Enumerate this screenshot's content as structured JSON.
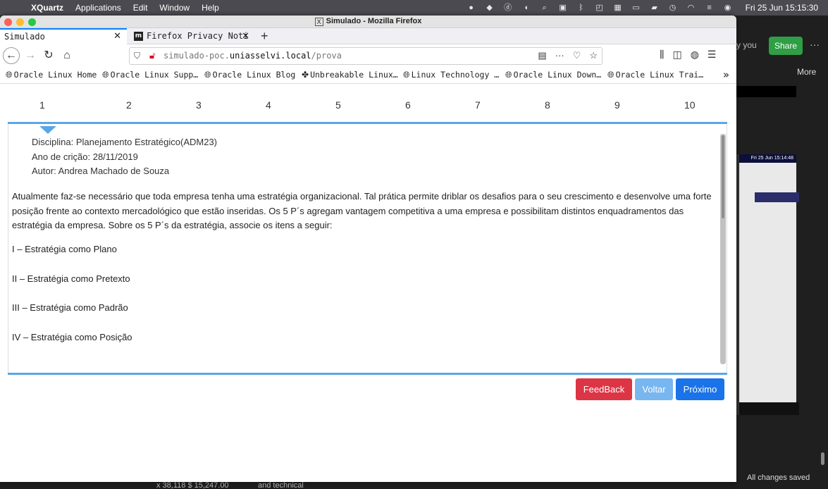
{
  "menubar": {
    "app": "XQuartz",
    "items": [
      "Applications",
      "Edit",
      "Window",
      "Help"
    ],
    "clock": "Fri 25 Jun  15:15:30"
  },
  "window": {
    "title": "Simulado - Mozilla Firefox"
  },
  "tabs": [
    {
      "label": "Simulado",
      "active": true
    },
    {
      "label": "Firefox Privacy Noti",
      "favicon": "m"
    }
  ],
  "urlbar": {
    "prefix": "simulado-poc.",
    "domain": "uniasselvi.local",
    "path": "/prova"
  },
  "bookmarks": [
    "Oracle Linux Home",
    "Oracle Linux Supp…",
    "Oracle Linux Blog",
    "Unbreakable Linux…",
    "Linux Technology …",
    "Oracle Linux Down…",
    "Oracle Linux Trai…"
  ],
  "question_numbers": [
    "1",
    "2",
    "3",
    "4",
    "5",
    "6",
    "7",
    "8",
    "9",
    "10"
  ],
  "question": {
    "discipline": "Disciplina: Planejamento Estratégico(ADM23)",
    "created": "Ano de crição: 28/11/2019",
    "author": "Autor: Andrea Machado de Souza",
    "text": "Atualmente faz-se necessário que toda empresa tenha uma estratégia organizacional. Tal prática permite driblar os desafios para o seu crescimento e desenvolve uma forte posição frente ao contexto mercadológico que estão inseridas. Os 5 P´s agregam vantagem competitiva a uma empresa e possibilitam distintos enquadramentos das estratégia da empresa. Sobre os 5 P´s da estratégia, associe os itens a seguir:",
    "items": [
      "I – Estratégia como Plano",
      "II – Estratégia como Pretexto",
      "III – Estratégia como Padrão",
      "IV – Estratégia como Posição"
    ]
  },
  "buttons": {
    "feedback": "FeedBack",
    "back": "Voltar",
    "next": "Próximo"
  },
  "background_app": {
    "you": "y you",
    "share": "Share",
    "more": "More",
    "mini_clock": "Fri 25 Jun  15:14:48",
    "saved": "All changes saved",
    "strip_1": "x 38,118 $ 15,247.00",
    "strip_2": "and technical"
  },
  "colors": {
    "feedback": "#dc3545",
    "back": "#78b6f0",
    "next": "#1a73e8",
    "accent_bar": "#5ba6e6"
  }
}
